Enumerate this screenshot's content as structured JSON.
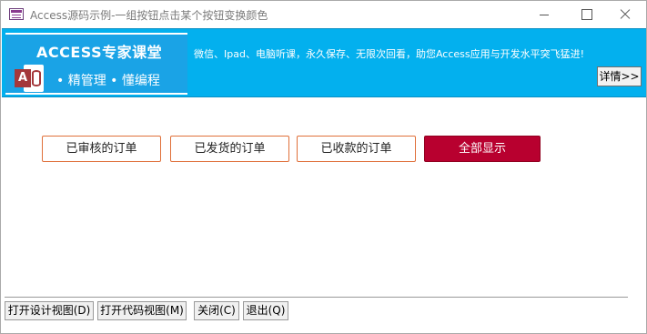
{
  "window": {
    "title": "Access源码示例-一组按钮点击某个按钮变换颜色"
  },
  "banner": {
    "logo_title": "ACCESS专家课堂",
    "logo_icon_letter": "A",
    "logo_subtitle": "• 精管理 • 懂编程",
    "promo_text": "微信、Ipad、电脑听课，永久保存、无限次回看，助您Access应用与开发水平突飞猛进!",
    "detail_button": "详情>>",
    "background_color": "#03b0ee"
  },
  "filters": {
    "audited": "已审核的订单",
    "shipped": "已发货的订单",
    "paid": "已收款的订单",
    "all": "全部显示",
    "selected": "all",
    "selected_color": "#b8002f",
    "border_color": "#e0703a"
  },
  "footer": {
    "design_view": "打开设计视图(D)",
    "code_view": "打开代码视图(M)",
    "close": "关闭(C)",
    "exit": "退出(Q)"
  }
}
